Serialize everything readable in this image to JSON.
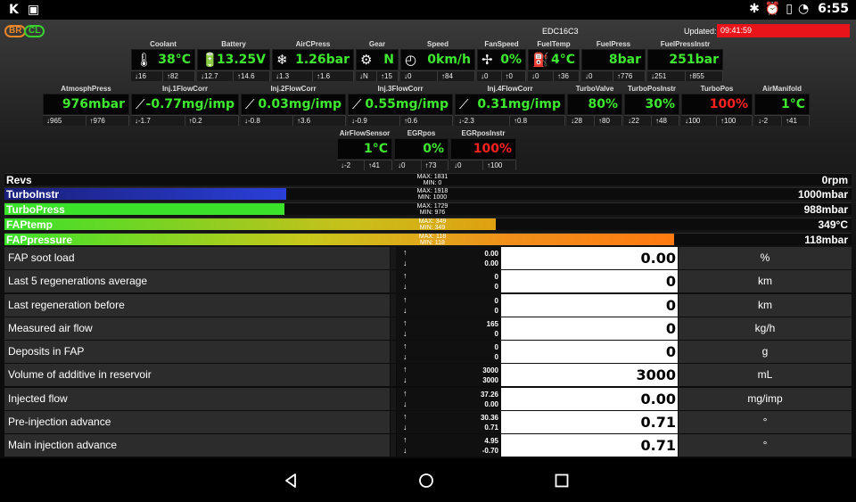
{
  "statusbar": {
    "left_icons": [
      "k-app-icon",
      "image-icon"
    ],
    "left_glyphs": [
      "K",
      "▣"
    ],
    "right_icons": [
      "bluetooth-icon",
      "alarm-icon",
      "vibrate-icon",
      "sync-icon"
    ],
    "right_glyphs": [
      "✱",
      "⏰",
      "▯",
      "◔"
    ],
    "time": "6:55"
  },
  "header": {
    "badge_br": "BR",
    "badge_cl": "CL",
    "ecu": "EDC16C3",
    "updated_label": "Updated:",
    "updated_time": "09:41:59"
  },
  "gauges": {
    "row1": [
      {
        "label": "Coolant",
        "icon": "coolant-thermometer-icon",
        "glyph": "🌡",
        "value": "38°C",
        "min": "16",
        "max": "82",
        "red": false
      },
      {
        "label": "Battery",
        "icon": "battery-icon",
        "glyph": "🔋",
        "value": "13.25V",
        "min": "12.7",
        "max": "14.6",
        "red": false
      },
      {
        "label": "AirCPress",
        "icon": "snowflake-icon",
        "glyph": "❄",
        "value": "1.26bar",
        "min": "1.3",
        "max": "1.6",
        "red": false
      },
      {
        "label": "Gear",
        "icon": "gearshift-icon",
        "glyph": "⚙",
        "value": "N",
        "min": "N",
        "max": "15",
        "red": false
      },
      {
        "label": "Speed",
        "icon": "speedometer-icon",
        "glyph": "◴",
        "value": "0km/h",
        "min": "0",
        "max": "84",
        "red": false
      },
      {
        "label": "FanSpeed",
        "icon": "fan-icon",
        "glyph": "✢",
        "value": "0%",
        "min": "0",
        "max": "0",
        "red": false
      },
      {
        "label": "FuelTemp",
        "icon": "fuel-pump-icon",
        "glyph": "⛽",
        "value": "4°C",
        "min": "0",
        "max": "36",
        "red": false
      },
      {
        "label": "FuelPress",
        "icon": "",
        "glyph": "",
        "value": "8bar",
        "min": "0",
        "max": "776",
        "red": false
      },
      {
        "label": "FuelPressInstr",
        "icon": "",
        "glyph": "",
        "value": "251bar",
        "min": "251",
        "max": "855",
        "red": false
      }
    ],
    "row2": [
      {
        "label": "AtmosphPress",
        "icon": "",
        "glyph": "",
        "value": "976mbar",
        "min": "965",
        "max": "976",
        "red": false
      },
      {
        "label": "Inj.1FlowCorr",
        "icon": "injector-icon",
        "glyph": "⟋",
        "value": "-0.77mg/imp",
        "min": "-1.7",
        "max": "0.2",
        "red": false
      },
      {
        "label": "Inj.2FlowCorr",
        "icon": "injector-icon",
        "glyph": "⟋",
        "value": "0.03mg/imp",
        "min": "-0.8",
        "max": "3.6",
        "red": false
      },
      {
        "label": "Inj.3FlowCorr",
        "icon": "injector-icon",
        "glyph": "⟋",
        "value": "0.55mg/imp",
        "min": "-0.9",
        "max": "0.6",
        "red": false
      },
      {
        "label": "Inj.4FlowCorr",
        "icon": "injector-icon",
        "glyph": "⟋",
        "value": "0.31mg/imp",
        "min": "-2.3",
        "max": "0.8",
        "red": false
      },
      {
        "label": "TurboValve",
        "icon": "",
        "glyph": "",
        "value": "80%",
        "min": "28",
        "max": "80",
        "red": false
      },
      {
        "label": "TurboPosInstr",
        "icon": "",
        "glyph": "",
        "value": "30%",
        "min": "22",
        "max": "48",
        "red": false
      },
      {
        "label": "TurboPos",
        "icon": "",
        "glyph": "",
        "value": "100%",
        "min": "100",
        "max": "100",
        "red": true
      },
      {
        "label": "AirManifold",
        "icon": "",
        "glyph": "",
        "value": "1°C",
        "min": "-2",
        "max": "41",
        "red": false
      }
    ],
    "row3": [
      {
        "label": "AirFlowSensor",
        "icon": "",
        "glyph": "",
        "value": "1°C",
        "min": "-2",
        "max": "41",
        "red": false
      },
      {
        "label": "EGRpos",
        "icon": "",
        "glyph": "",
        "value": "0%",
        "min": "0",
        "max": "73",
        "red": false
      },
      {
        "label": "EGRposInstr",
        "icon": "",
        "glyph": "",
        "value": "100%",
        "min": "0",
        "max": "100",
        "red": true
      }
    ]
  },
  "bars": [
    {
      "name": "Revs",
      "value": "0rpm",
      "max": "MAX: 1831",
      "min": "MIN: 0",
      "fill_fraction": 0.0,
      "gradient": "none"
    },
    {
      "name": "TurboInstr",
      "value": "1000mbar",
      "max": "MAX: 1918",
      "min": "MIN: 1000",
      "fill_fraction": 0.333,
      "gradient": "blue"
    },
    {
      "name": "TurboPress",
      "value": "988mbar",
      "max": "MAX: 1729",
      "min": "MIN: 976",
      "fill_fraction": 0.33,
      "gradient": "green"
    },
    {
      "name": "FAPtemp",
      "value": "349°C",
      "max": "MAX: 349",
      "min": "MIN: 349",
      "fill_fraction": 0.58,
      "gradient": "green-yellow"
    },
    {
      "name": "FAPpressure",
      "value": "118mbar",
      "max": "MAX: 118",
      "min": "MIN: 118",
      "fill_fraction": 0.79,
      "gradient": "green-orange"
    }
  ],
  "params": [
    {
      "name": "FAP soot load",
      "max": "0.00",
      "min": "0.00",
      "value": "0.00",
      "unit": "%"
    },
    {
      "name": "Last 5 regenerations average",
      "max": "0",
      "min": "0",
      "value": "0",
      "unit": "km"
    },
    {
      "name": "Last regeneration before",
      "max": "0",
      "min": "0",
      "value": "0",
      "unit": "km"
    },
    {
      "name": "Measured air flow",
      "max": "165",
      "min": "0",
      "value": "0",
      "unit": "kg/h"
    },
    {
      "name": "Deposits in FAP",
      "max": "0",
      "min": "0",
      "value": "0",
      "unit": "g"
    },
    {
      "name": "Volume of additive in reservoir",
      "max": "3000",
      "min": "3000",
      "value": "3000",
      "unit": "mL"
    },
    {
      "name": "Injected flow",
      "max": "37.26",
      "min": "0.00",
      "value": "0.00",
      "unit": "mg/imp"
    },
    {
      "name": "Pre-injection advance",
      "max": "30.36",
      "min": "0.71",
      "value": "0.71",
      "unit": "°"
    },
    {
      "name": "Main injection advance",
      "max": "4.95",
      "min": "-0.70",
      "value": "0.71",
      "unit": "°"
    }
  ],
  "arrows": {
    "up": "↑",
    "down": "↓",
    "min_prefix": "↓",
    "max_prefix": "↑"
  },
  "colors": {
    "value_green": "#3fe830",
    "value_red": "#ff2020",
    "updated_bg": "#e8141a",
    "badge_br": "#e8862a",
    "badge_cl": "#39d12d"
  },
  "navbar": {
    "icons": [
      "back-icon",
      "home-icon",
      "recents-icon"
    ]
  }
}
